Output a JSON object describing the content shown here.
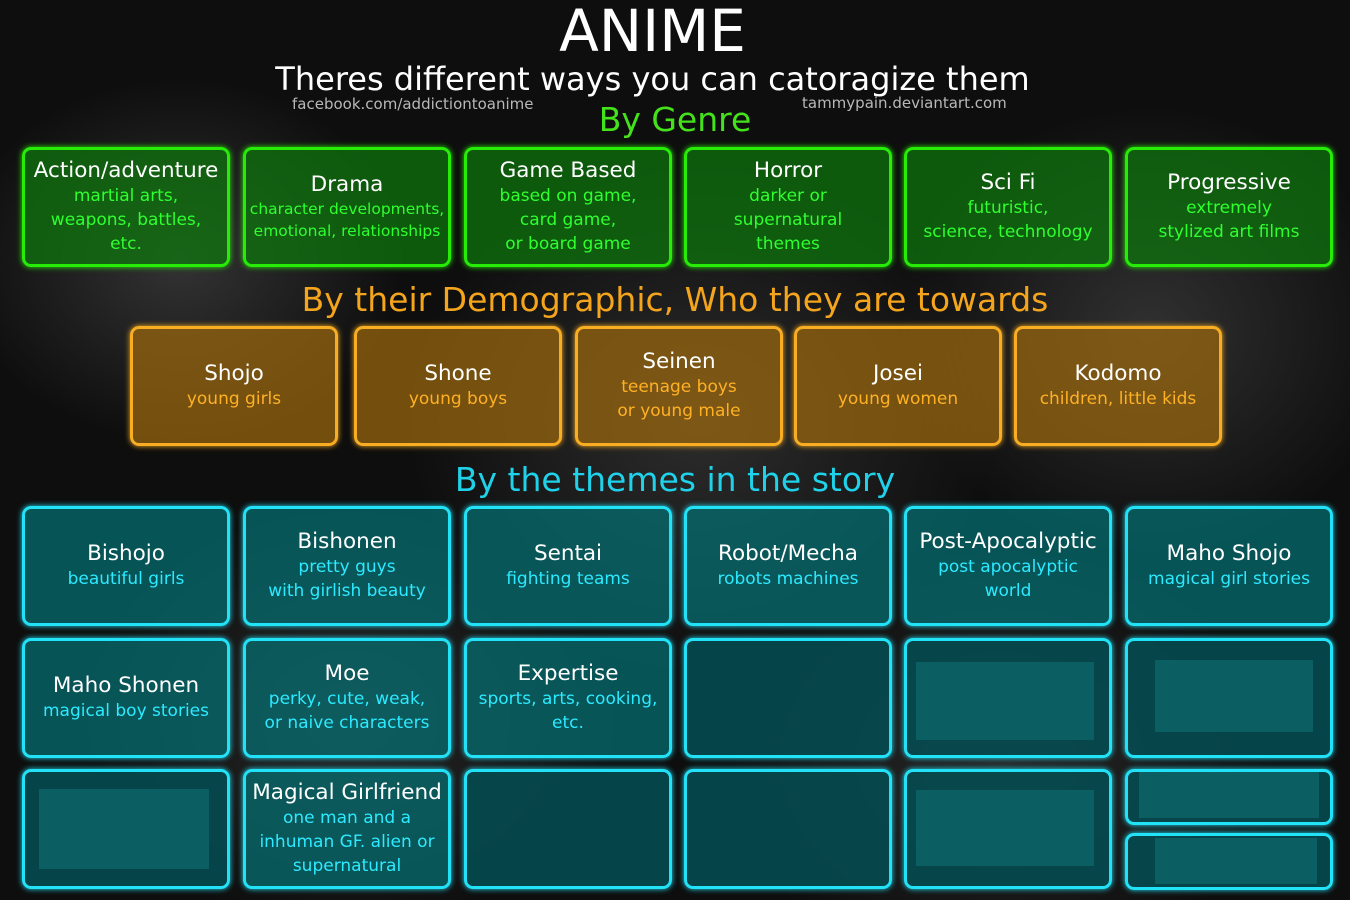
{
  "header": {
    "title": "ANIME",
    "subtitle": "Theres different ways you can catoragize them",
    "credit_left": "facebook.com/addictiontoanime",
    "credit_right": "tammypain.deviantart.com"
  },
  "sections": {
    "genre": {
      "heading": "By Genre"
    },
    "demographic": {
      "heading": "By their Demographic, Who they are towards"
    },
    "themes": {
      "heading": "By the themes in the story"
    }
  },
  "genre_boxes": [
    {
      "title": "Action/adventure",
      "desc": "martial arts,\nweapons, battles,\netc."
    },
    {
      "title": "Drama",
      "desc": "character developments,\nemotional, relationships"
    },
    {
      "title": "Game Based",
      "desc": "based on game,\ncard game,\nor board game"
    },
    {
      "title": "Horror",
      "desc": "darker or\nsupernatural\nthemes"
    },
    {
      "title": "Sci Fi",
      "desc": "futuristic,\nscience, technology"
    },
    {
      "title": "Progressive",
      "desc": "extremely\nstylized art films"
    }
  ],
  "demographic_boxes": [
    {
      "title": "Shojo",
      "desc": "young girls"
    },
    {
      "title": "Shone",
      "desc": "young boys"
    },
    {
      "title": "Seinen",
      "desc": "teenage boys\nor young male"
    },
    {
      "title": "Josei",
      "desc": "young women"
    },
    {
      "title": "Kodomo",
      "desc": "children, little kids"
    }
  ],
  "theme_boxes": [
    {
      "title": "Bishojo",
      "desc": "beautiful girls"
    },
    {
      "title": "Bishonen",
      "desc": "pretty guys\nwith girlish beauty"
    },
    {
      "title": "Sentai",
      "desc": "fighting teams"
    },
    {
      "title": "Robot/Mecha",
      "desc": "robots machines"
    },
    {
      "title": "Post-Apocalyptic",
      "desc": "post apocalyptic\nworld"
    },
    {
      "title": "Maho Shojo",
      "desc": "magical girl stories"
    },
    {
      "title": "Maho Shonen",
      "desc": "magical boy stories"
    },
    {
      "title": "Moe",
      "desc": "perky, cute, weak,\nor naive characters"
    },
    {
      "title": "Expertise",
      "desc": "sports, arts, cooking,\netc."
    },
    {
      "title": "Magical Girlfriend",
      "desc": "one man and a\ninhuman GF. alien or\nsupernatural"
    }
  ],
  "colors": {
    "genre_accent": "#27ec07",
    "demographic_accent": "#f8ad22",
    "theme_accent": "#22e2f8"
  }
}
